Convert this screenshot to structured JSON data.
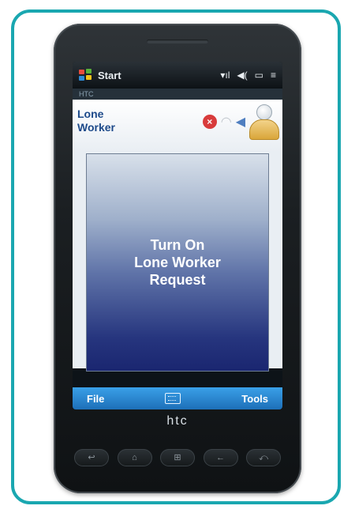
{
  "status_bar": {
    "start_label": "Start",
    "icons": [
      "signal-icon",
      "speaker-icon",
      "battery-icon",
      "connectivity-icon"
    ]
  },
  "carrier_strip": {
    "text": "HTC"
  },
  "app": {
    "title": "Lone\nWorker",
    "header_icons": [
      "cancel-icon",
      "wifi-icon",
      "volume-icon",
      "user-icon"
    ]
  },
  "request_button": {
    "label": "Turn On\nLone Worker\nRequest"
  },
  "menu_bar": {
    "left_label": "File",
    "right_label": "Tools",
    "center_icon": "keyboard-icon"
  },
  "device": {
    "brand": "htc"
  },
  "colors": {
    "frame": "#1aa7b0",
    "menu_bar": "#2a86d0",
    "title": "#1d4a8a"
  }
}
